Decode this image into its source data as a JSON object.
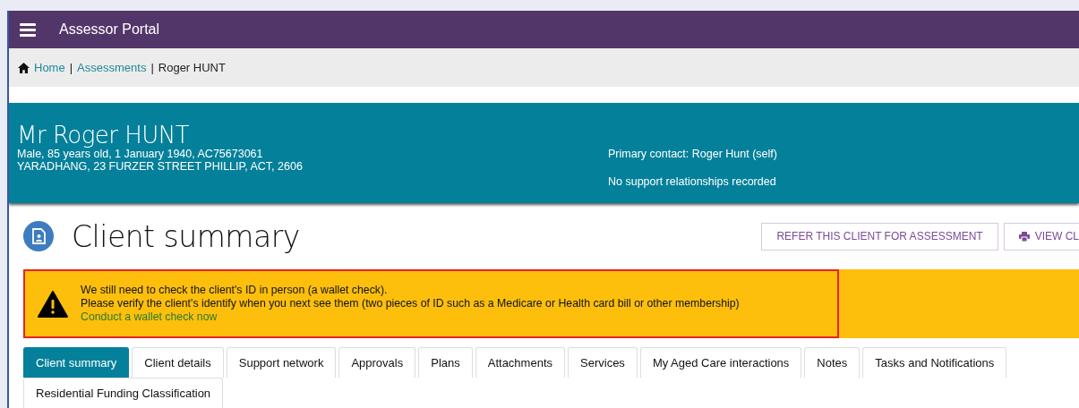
{
  "app_bar": {
    "title": "Assessor Portal"
  },
  "breadcrumb": [
    {
      "label": "Home",
      "kind": "link"
    },
    {
      "label": "|",
      "kind": "separator"
    },
    {
      "label": "Assessments",
      "kind": "link"
    },
    {
      "label": "|",
      "kind": "separator"
    },
    {
      "label": "Roger HUNT",
      "kind": "current"
    }
  ],
  "client": {
    "name": "Mr Roger HUNT",
    "details": "Male, 85 years old, 1 January 1940, AC75673061",
    "address": "YARADHANG, 23 FURZER STREET PHILLIP, ACT, 2606",
    "primary_contact": "Primary contact: Roger Hunt (self)",
    "support": "No support relationships recorded"
  },
  "page_title": "Client summary",
  "actions": [
    {
      "label": "REFER THIS CLIENT FOR ASSESSMENT",
      "kind": "plain"
    },
    {
      "label": "VIEW CL",
      "kind": "print"
    }
  ],
  "alert": {
    "lines": [
      "We still need to check the client's ID in person (a wallet check).",
      "Please verify the client's identify when you next see them (two pieces of ID such as a Medicare or Health card bill or other membership)"
    ],
    "link": "Conduct a wallet check now"
  },
  "tabs": [
    {
      "label": "Client summary",
      "selected": true
    },
    {
      "label": "Client details",
      "selected": false
    },
    {
      "label": "Support network",
      "selected": false
    },
    {
      "label": "Approvals",
      "selected": false
    },
    {
      "label": "Plans",
      "selected": false
    },
    {
      "label": "Attachments",
      "selected": false
    },
    {
      "label": "Services",
      "selected": false
    },
    {
      "label": "My Aged Care interactions",
      "selected": false
    },
    {
      "label": "Notes",
      "selected": false
    },
    {
      "label": "Tasks and Notifications",
      "selected": false
    },
    {
      "label": "Residential Funding Classification",
      "selected": false
    }
  ]
}
